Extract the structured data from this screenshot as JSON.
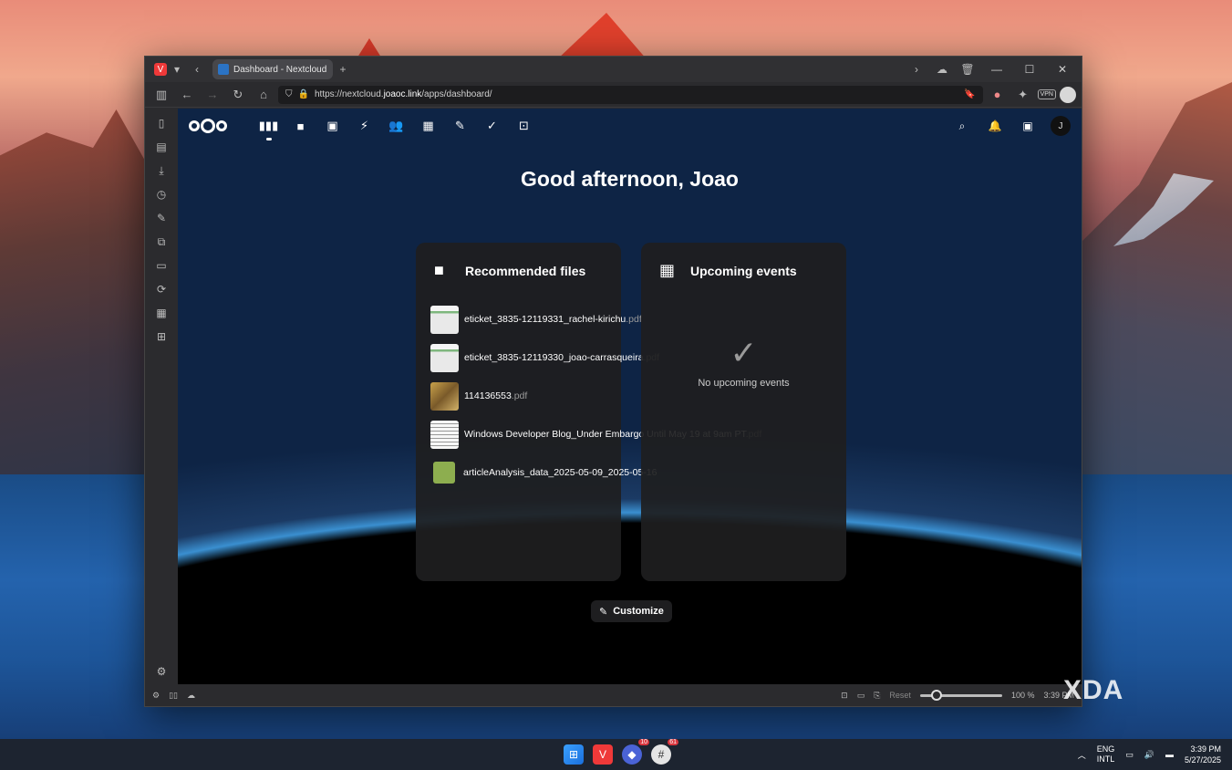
{
  "browser": {
    "tab_title": "Dashboard - Nextcloud",
    "url_prefix": "https://nextcloud.",
    "url_domain": "joaoc.link",
    "url_suffix": "/apps/dashboard/",
    "vpn_label": "VPN"
  },
  "nextcloud": {
    "greeting": "Good afternoon, Joao",
    "user_initial": "J",
    "apps": [
      "dashboard",
      "files",
      "photos",
      "activity",
      "contacts",
      "calendar",
      "notes",
      "tasks",
      "deck"
    ],
    "recommended": {
      "title": "Recommended files",
      "files": [
        {
          "name": "eticket_3835-12119331_rachel-kirichu",
          "ext": ".pdf",
          "thumb": "doc"
        },
        {
          "name": "eticket_3835-12119330_joao-carrasqueira",
          "ext": ".pdf",
          "thumb": "doc"
        },
        {
          "name": "114136553",
          "ext": ".pdf",
          "thumb": "img"
        },
        {
          "name": "Windows Developer Blog_Under Embargo Until May 19 at 9am PT",
          "ext": ".pdf",
          "thumb": "txt"
        },
        {
          "name": "articleAnalysis_data_2025-05-09_2025-05-16",
          "ext": "",
          "thumb": "sheet"
        }
      ]
    },
    "events": {
      "title": "Upcoming events",
      "empty_text": "No upcoming events"
    },
    "customize_label": "Customize"
  },
  "statusbar": {
    "reset_label": "Reset",
    "zoom": "100 %",
    "time": "3:39 PM",
    "zoom_level": 0.2
  },
  "taskbar": {
    "badge_a": "10",
    "badge_b": "61",
    "lang_top": "ENG",
    "lang_bottom": "INTL",
    "time": "3:39 PM",
    "date": "5/27/2025"
  },
  "watermark": "XDA"
}
